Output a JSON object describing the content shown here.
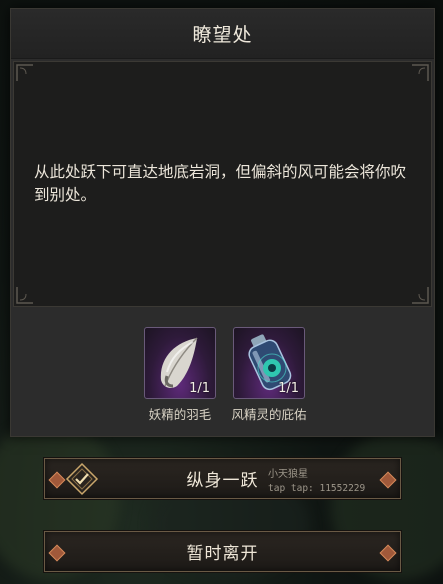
{
  "dialog": {
    "title": "瞭望处",
    "description": "从此处跃下可直达地底岩洞，但偏斜的风可能会将你吹到别处。"
  },
  "rewards": [
    {
      "name": "妖精的羽毛",
      "count": "1/1",
      "icon": "feather-icon"
    },
    {
      "name": "风精灵的庇佑",
      "count": "1/1",
      "icon": "spirit-bottle-icon"
    }
  ],
  "actions": {
    "jump_label": "纵身一跃",
    "leave_label": "暂时离开"
  },
  "watermark": {
    "line1": "小天狼星",
    "line2": "tap tap: 11552229"
  },
  "colors": {
    "panel": "#2c2c2c",
    "text_panel": "#1d1d1c",
    "button_border": "#6a5a45",
    "accent": "#a0593a"
  }
}
